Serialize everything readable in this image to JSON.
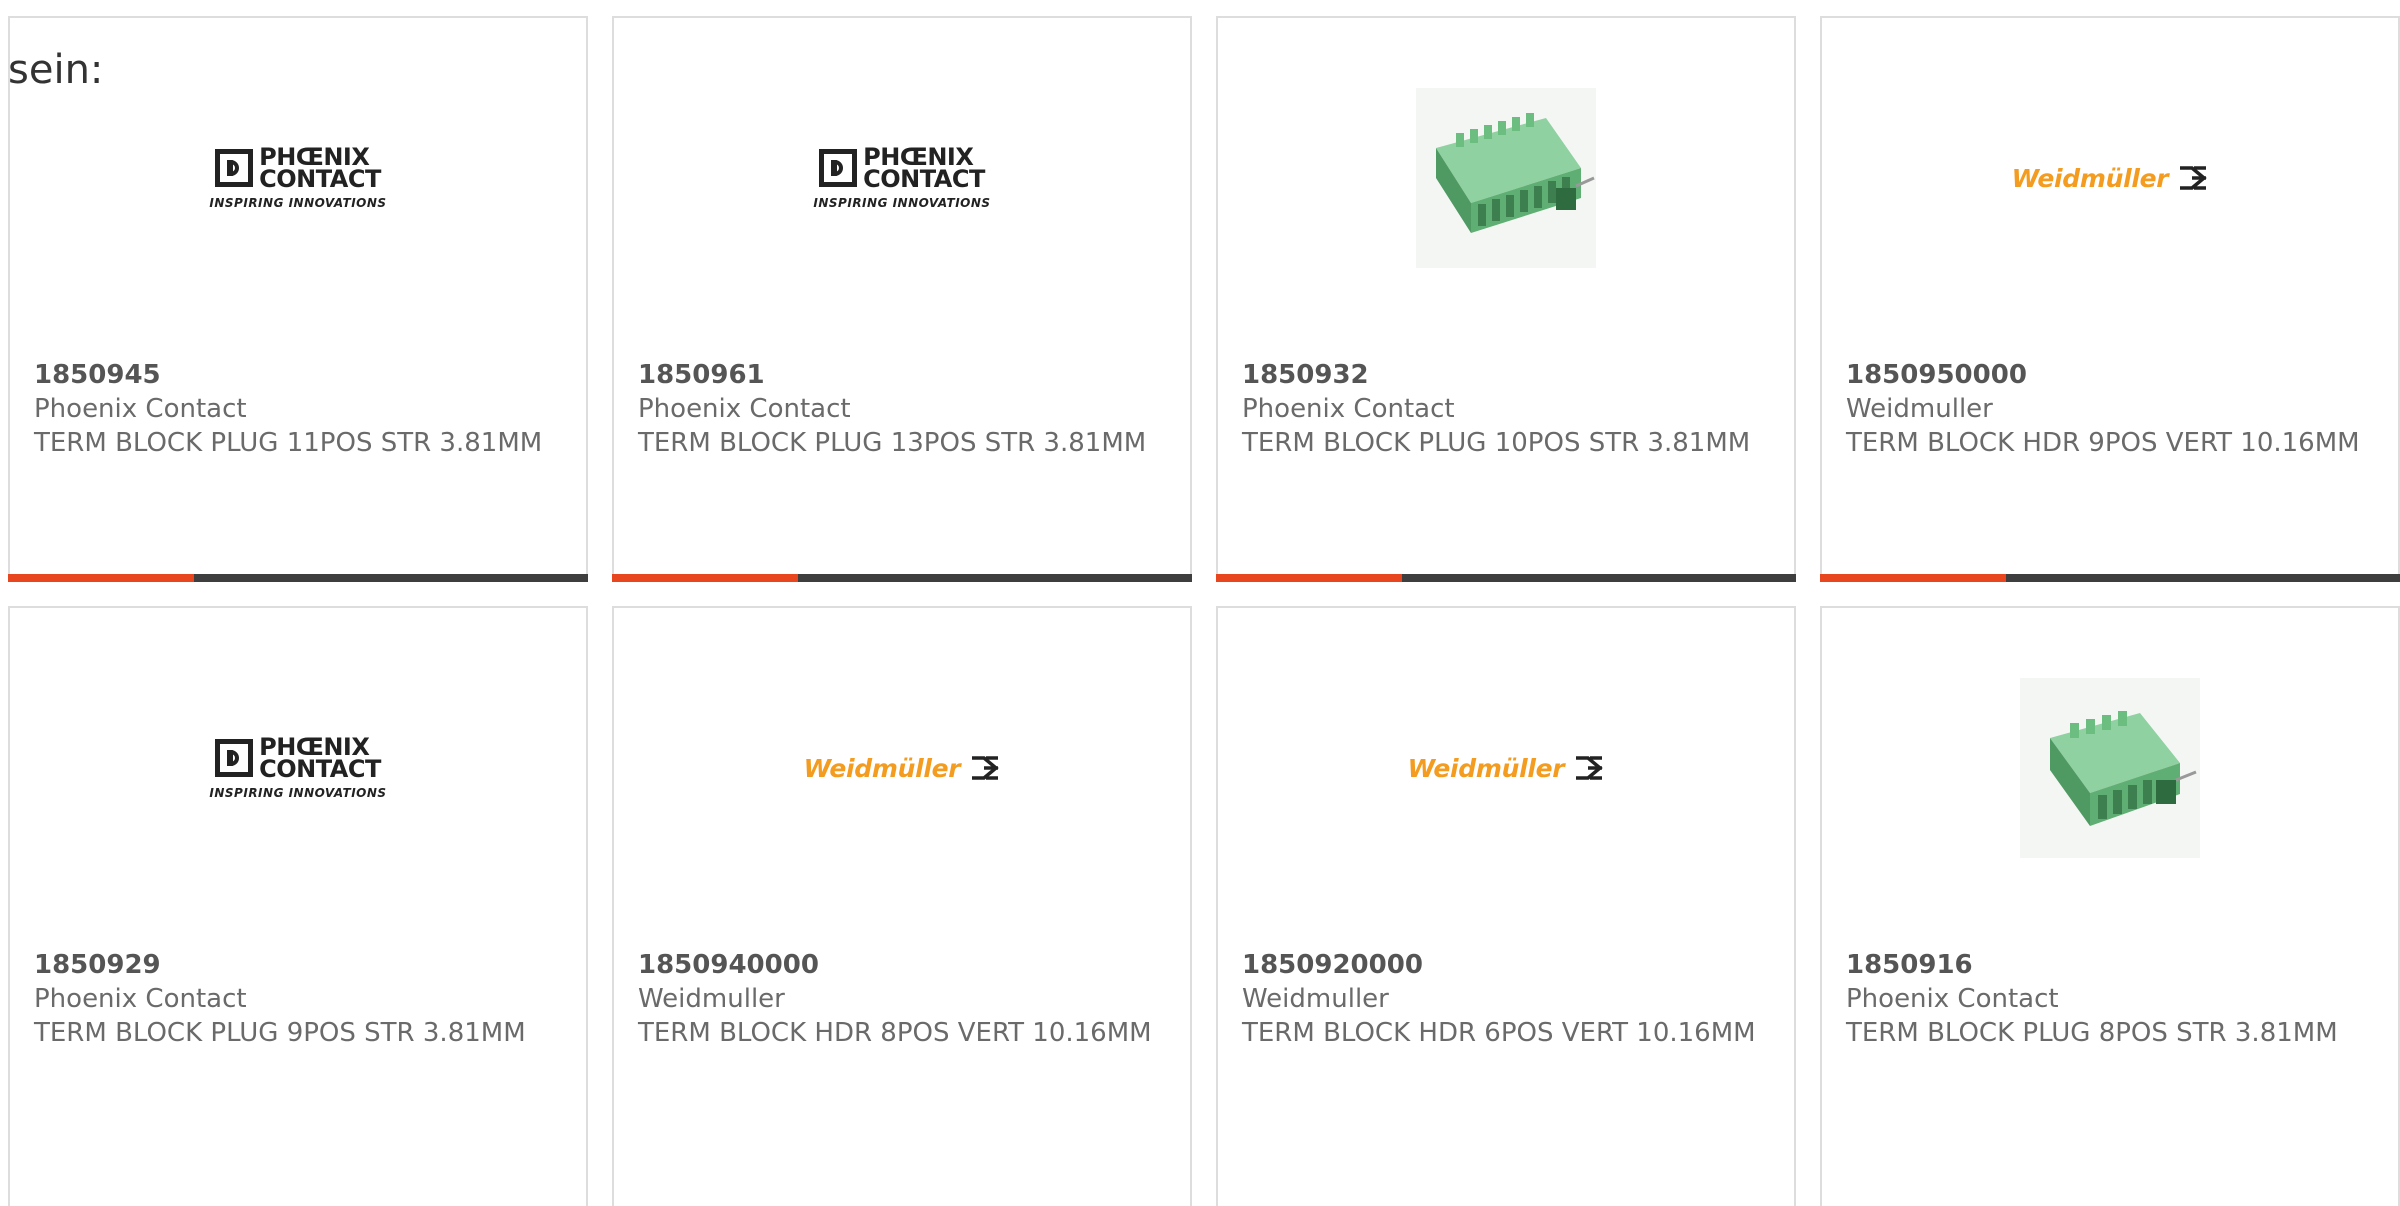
{
  "intro_text": "sein:",
  "accent_color": "#e8461e",
  "products": [
    {
      "part_number": "1850945",
      "manufacturer": "Phoenix Contact",
      "description": "TERM BLOCK PLUG 11POS STR 3.81MM",
      "image": "phoenix-contact-logo",
      "logo_tagline": "INSPIRING INNOVATIONS",
      "progress": 0.32
    },
    {
      "part_number": "1850961",
      "manufacturer": "Phoenix Contact",
      "description": "TERM BLOCK PLUG 13POS STR 3.81MM",
      "image": "phoenix-contact-logo",
      "logo_tagline": "INSPIRING INNOVATIONS",
      "progress": 0.32
    },
    {
      "part_number": "1850932",
      "manufacturer": "Phoenix Contact",
      "description": "TERM BLOCK PLUG 10POS STR 3.81MM",
      "image": "green-terminal-block-photo",
      "progress": 0.32
    },
    {
      "part_number": "1850950000",
      "manufacturer": "Weidmuller",
      "description": "TERM BLOCK HDR 9POS VERT 10.16MM",
      "image": "weidmuller-logo",
      "logo_text": "Weidmüller",
      "progress": 0.32
    },
    {
      "part_number": "1850929",
      "manufacturer": "Phoenix Contact",
      "description": "TERM BLOCK PLUG 9POS STR 3.81MM",
      "image": "phoenix-contact-logo",
      "logo_tagline": "INSPIRING INNOVATIONS"
    },
    {
      "part_number": "1850940000",
      "manufacturer": "Weidmuller",
      "description": "TERM BLOCK HDR 8POS VERT 10.16MM",
      "image": "weidmuller-logo",
      "logo_text": "Weidmüller"
    },
    {
      "part_number": "1850920000",
      "manufacturer": "Weidmuller",
      "description": "TERM BLOCK HDR 6POS VERT 10.16MM",
      "image": "weidmuller-logo",
      "logo_text": "Weidmüller"
    },
    {
      "part_number": "1850916",
      "manufacturer": "Phoenix Contact",
      "description": "TERM BLOCK PLUG 8POS STR 3.81MM",
      "image": "green-terminal-block-photo"
    }
  ]
}
